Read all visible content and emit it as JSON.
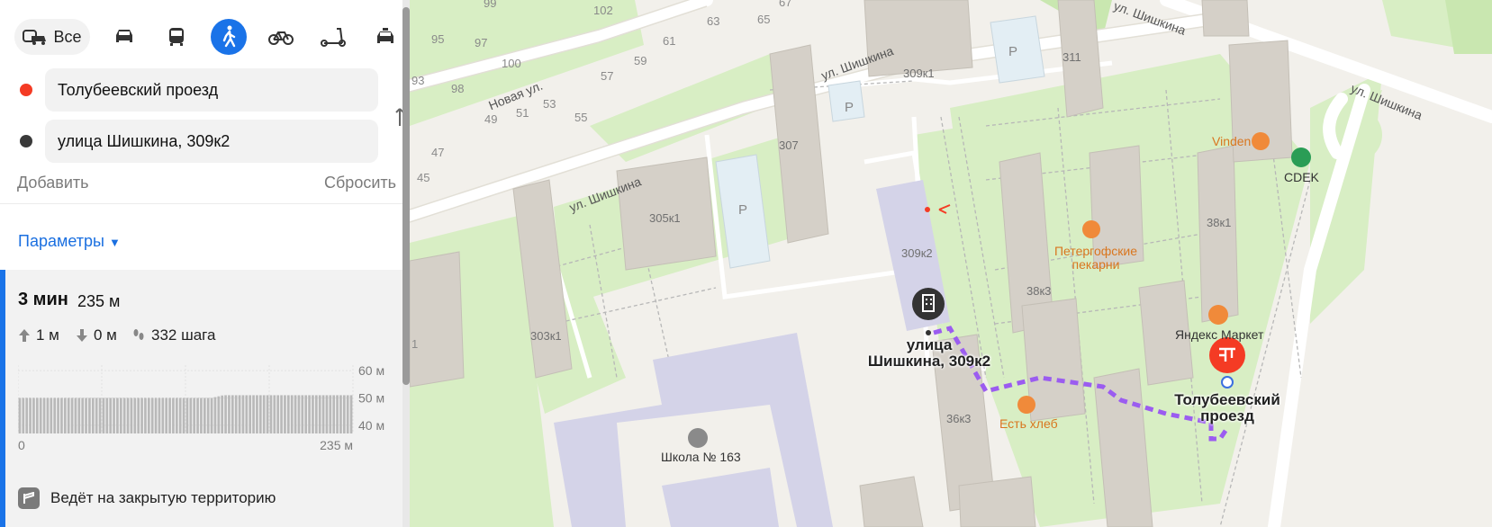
{
  "transport": {
    "all_label": "Все",
    "modes": [
      "car-icon",
      "bus-icon",
      "pedestrian-icon",
      "bicycle-icon",
      "scooter-icon",
      "taxi-icon"
    ],
    "active": "pedestrian"
  },
  "route_points": {
    "from": "Толубеевский проезд",
    "to": "улица Шишкина, 309к2",
    "from_color": "#f43b24",
    "to_color": "#3a3a3a"
  },
  "actions": {
    "add": "Добавить",
    "reset": "Сбросить"
  },
  "params_label": "Параметры",
  "route": {
    "time": "3 мин",
    "distance": "235 м",
    "ascent": "1 м",
    "descent": "0 м",
    "steps": "332 шага"
  },
  "chart_data": {
    "type": "bar",
    "title": "",
    "xlabel": "",
    "ylabel": "",
    "ylim": [
      37,
      62
    ],
    "y_ticks": [
      "60 м",
      "50 м",
      "40 м"
    ],
    "y_tick_values": [
      60,
      50,
      40
    ],
    "x_tick_labels": [
      "0",
      "235 м"
    ],
    "values": [
      50,
      50,
      50,
      50,
      50,
      50,
      50,
      50,
      50,
      50,
      50,
      50,
      50,
      50,
      50,
      50,
      50,
      50,
      50,
      50,
      50,
      50,
      50,
      50,
      50,
      50,
      50,
      50,
      50,
      50,
      50,
      50,
      50,
      50,
      50,
      50,
      50,
      50,
      50,
      50,
      50,
      50,
      50,
      50,
      50,
      50,
      50,
      50,
      50,
      50,
      50,
      50,
      50,
      50,
      50,
      50,
      50.3,
      50.6,
      50.9,
      51,
      51,
      51,
      51,
      51,
      51,
      51,
      51,
      51,
      51,
      51,
      51,
      51,
      51,
      51,
      51,
      51,
      51,
      51,
      51,
      51,
      51,
      51,
      51,
      51,
      51,
      51,
      51,
      51,
      51,
      51,
      51,
      51,
      51,
      51,
      51,
      51
    ],
    "grid": true,
    "bar_color": "#b9b9b9"
  },
  "warning": "Ведёт на закрытую территорию",
  "map": {
    "streets": [
      "Новая ул.",
      "ул. Шишкина",
      "ул. Шишкина",
      "ул. Шишкина",
      "ул. Шишкина"
    ],
    "house_numbers": [
      "99",
      "102",
      "67",
      "95",
      "97",
      "63",
      "65",
      "61",
      "100",
      "93",
      "98",
      "57",
      "59",
      "49",
      "51",
      "53",
      "55",
      "47",
      "45",
      "309к1",
      "311",
      "307",
      "305к1",
      "38к1",
      "309к2",
      "38к3",
      "36к3",
      "303к1",
      "1"
    ],
    "pois": {
      "vinden": "Vinden",
      "cdek": "CDEK",
      "petergof": "Петергофские пекарни",
      "market": "Яндекс Маркет",
      "bread": "Есть хлеб",
      "school": "Школа № 163"
    },
    "parking": "P",
    "start_label": "Толубеевский проезд",
    "end_label": "улица Шишкина, 309к2",
    "colors": {
      "route": "#9b5cf0",
      "accent": "#f43b24",
      "green": "#d8eec4"
    }
  }
}
